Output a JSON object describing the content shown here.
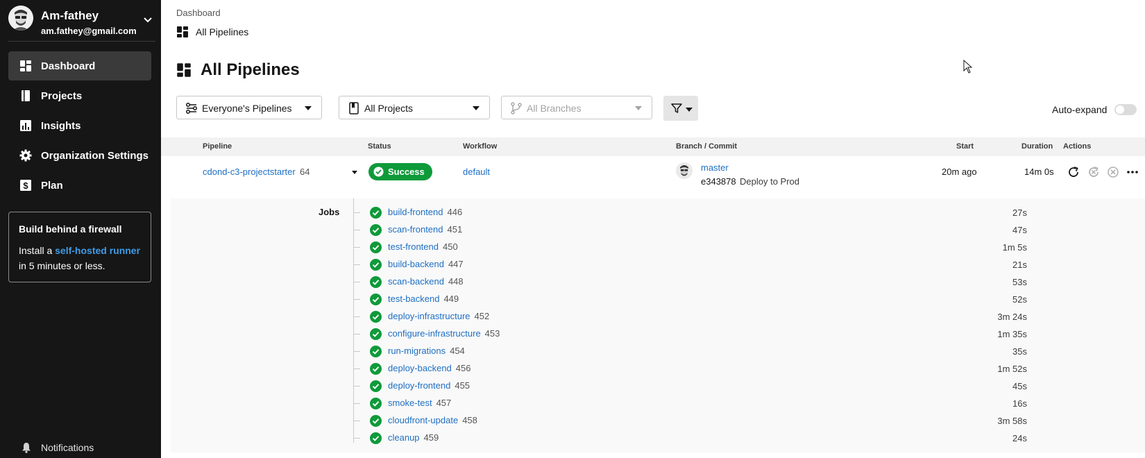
{
  "user": {
    "name": "Am-fathey",
    "email": "am.fathey@gmail.com"
  },
  "sidebar": {
    "items": [
      {
        "label": "Dashboard",
        "icon": "dashboard-icon",
        "active": true
      },
      {
        "label": "Projects",
        "icon": "book-icon"
      },
      {
        "label": "Insights",
        "icon": "bar-chart-icon"
      },
      {
        "label": "Organization Settings",
        "icon": "gear-icon"
      },
      {
        "label": "Plan",
        "icon": "dollar-icon"
      }
    ],
    "promo": {
      "title": "Build behind a firewall",
      "prefix": "Install a",
      "link": "self-hosted runner",
      "suffix": "in 5 minutes or less."
    },
    "notifications": "Notifications"
  },
  "breadcrumb": {
    "parent": "Dashboard",
    "current": "All Pipelines"
  },
  "page_title": "All Pipelines",
  "filters": {
    "pipelines": "Everyone's Pipelines",
    "projects": "All Projects",
    "branches": "All Branches",
    "auto_expand": "Auto-expand",
    "auto_expand_on": false
  },
  "table": {
    "headers": {
      "pipeline": "Pipeline",
      "status": "Status",
      "workflow": "Workflow",
      "branch_commit": "Branch / Commit",
      "start": "Start",
      "duration": "Duration",
      "actions": "Actions"
    },
    "pipeline": {
      "name": "cdond-c3-projectstarter",
      "number": "64",
      "status": "Success",
      "workflow": "default",
      "branch": "master",
      "commit_sha": "e343878",
      "commit_message": "Deploy to Prod",
      "start": "20m ago",
      "duration": "14m 0s"
    },
    "jobs_label": "Jobs",
    "jobs": [
      {
        "name": "build-frontend",
        "number": "446",
        "duration": "27s"
      },
      {
        "name": "scan-frontend",
        "number": "451",
        "duration": "47s"
      },
      {
        "name": "test-frontend",
        "number": "450",
        "duration": "1m 5s"
      },
      {
        "name": "build-backend",
        "number": "447",
        "duration": "21s"
      },
      {
        "name": "scan-backend",
        "number": "448",
        "duration": "53s"
      },
      {
        "name": "test-backend",
        "number": "449",
        "duration": "52s"
      },
      {
        "name": "deploy-infrastructure",
        "number": "452",
        "duration": "3m 24s"
      },
      {
        "name": "configure-infrastructure",
        "number": "453",
        "duration": "1m 35s"
      },
      {
        "name": "run-migrations",
        "number": "454",
        "duration": "35s"
      },
      {
        "name": "deploy-backend",
        "number": "456",
        "duration": "1m 52s"
      },
      {
        "name": "deploy-frontend",
        "number": "455",
        "duration": "45s"
      },
      {
        "name": "smoke-test",
        "number": "457",
        "duration": "16s"
      },
      {
        "name": "cloudfront-update",
        "number": "458",
        "duration": "3m 58s"
      },
      {
        "name": "cleanup",
        "number": "459",
        "duration": "24s"
      }
    ]
  },
  "colors": {
    "sidebar_bg": "#161616",
    "link": "#1f6fc2",
    "success": "#0f9a3a",
    "promo_link": "#3f9ce8"
  }
}
